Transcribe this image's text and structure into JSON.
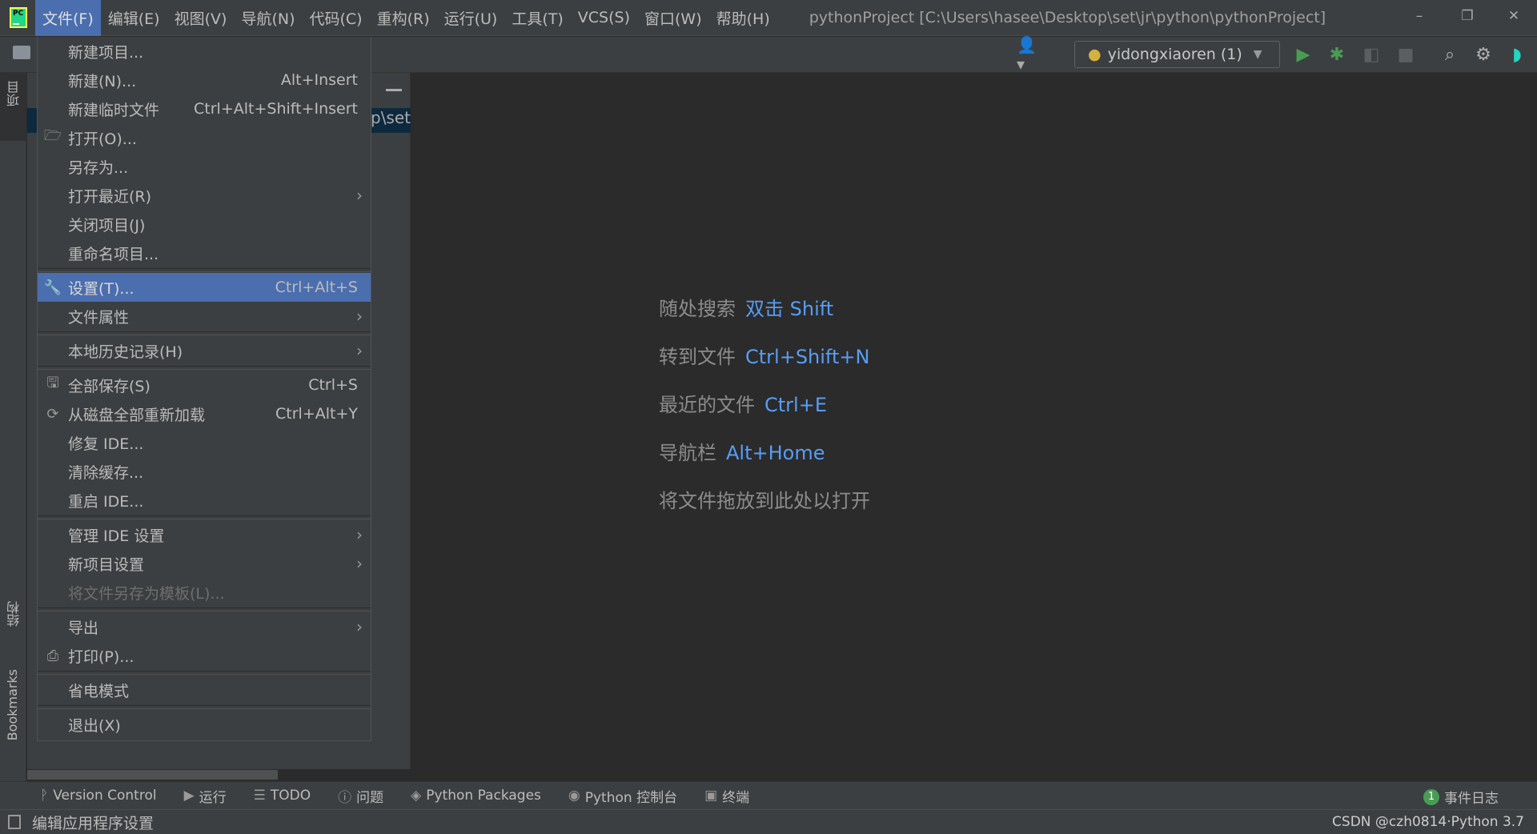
{
  "menubar": {
    "items": [
      "文件(F)",
      "编辑(E)",
      "视图(V)",
      "导航(N)",
      "代码(C)",
      "重构(R)",
      "运行(U)",
      "工具(T)",
      "VCS(S)",
      "窗口(W)",
      "帮助(H)"
    ],
    "active_index": 0
  },
  "window": {
    "title": "pythonProject [C:\\Users\\hasee\\Desktop\\set\\jr\\python\\pythonProject]",
    "minimize": "–",
    "restore": "❐",
    "close": "✕",
    "logo_text": "PC"
  },
  "toolbar": {
    "run_config": "yidongxiaoren (1)"
  },
  "left_strip": {
    "project": "项目",
    "structure": "结构",
    "bookmarks": "Bookmarks"
  },
  "project_panel": {
    "path_fragment": "p\\set"
  },
  "file_menu": {
    "groups": [
      [
        {
          "label": "新建项目...",
          "shortcut": "",
          "icon": "",
          "submenu": false
        },
        {
          "label": "新建(N)...",
          "shortcut": "Alt+Insert",
          "icon": "",
          "submenu": false
        },
        {
          "label": "新建临时文件",
          "shortcut": "Ctrl+Alt+Shift+Insert",
          "icon": "",
          "submenu": false
        },
        {
          "label": "打开(O)...",
          "shortcut": "",
          "icon": "folder-open-icon",
          "submenu": false
        },
        {
          "label": "另存为...",
          "shortcut": "",
          "icon": "",
          "submenu": false
        },
        {
          "label": "打开最近(R)",
          "shortcut": "",
          "icon": "",
          "submenu": true
        },
        {
          "label": "关闭项目(J)",
          "shortcut": "",
          "icon": "",
          "submenu": false
        },
        {
          "label": "重命名项目...",
          "shortcut": "",
          "icon": "",
          "submenu": false
        }
      ],
      [
        {
          "label": "设置(T)...",
          "shortcut": "Ctrl+Alt+S",
          "icon": "wrench-icon",
          "submenu": false,
          "highlighted": true
        },
        {
          "label": "文件属性",
          "shortcut": "",
          "icon": "",
          "submenu": true
        }
      ],
      [
        {
          "label": "本地历史记录(H)",
          "shortcut": "",
          "icon": "",
          "submenu": true
        }
      ],
      [
        {
          "label": "全部保存(S)",
          "shortcut": "Ctrl+S",
          "icon": "save-icon",
          "submenu": false
        },
        {
          "label": "从磁盘全部重新加载",
          "shortcut": "Ctrl+Alt+Y",
          "icon": "reload-icon",
          "submenu": false
        },
        {
          "label": "修复 IDE...",
          "shortcut": "",
          "icon": "",
          "submenu": false
        },
        {
          "label": "清除缓存...",
          "shortcut": "",
          "icon": "",
          "submenu": false
        },
        {
          "label": "重启 IDE...",
          "shortcut": "",
          "icon": "",
          "submenu": false
        }
      ],
      [
        {
          "label": "管理 IDE 设置",
          "shortcut": "",
          "icon": "",
          "submenu": true
        },
        {
          "label": "新项目设置",
          "shortcut": "",
          "icon": "",
          "submenu": true
        },
        {
          "label": "将文件另存为模板(L)...",
          "shortcut": "",
          "icon": "",
          "submenu": false,
          "disabled": true
        }
      ],
      [
        {
          "label": "导出",
          "shortcut": "",
          "icon": "",
          "submenu": true
        },
        {
          "label": "打印(P)...",
          "shortcut": "",
          "icon": "print-icon",
          "submenu": false
        }
      ],
      [
        {
          "label": "省电模式",
          "shortcut": "",
          "icon": "",
          "submenu": false
        }
      ],
      [
        {
          "label": "退出(X)",
          "shortcut": "",
          "icon": "",
          "submenu": false
        }
      ]
    ]
  },
  "welcome": [
    {
      "text": "随处搜索",
      "key": "双击 Shift"
    },
    {
      "text": "转到文件",
      "key": "Ctrl+Shift+N"
    },
    {
      "text": "最近的文件",
      "key": "Ctrl+E"
    },
    {
      "text": "导航栏",
      "key": "Alt+Home"
    },
    {
      "text": "将文件拖放到此处以打开",
      "key": ""
    }
  ],
  "tool_windows": [
    "Version Control",
    "运行",
    "TODO",
    "问题",
    "Python Packages",
    "Python 控制台",
    "终端"
  ],
  "event_log": {
    "count": "1",
    "label": "事件日志"
  },
  "status": {
    "message": "编辑应用程序设置",
    "right": "CSDN @czh0814·Python 3.7"
  },
  "colors": {
    "accent": "#4b6eaf",
    "link": "#589df6",
    "run": "#499c54"
  }
}
